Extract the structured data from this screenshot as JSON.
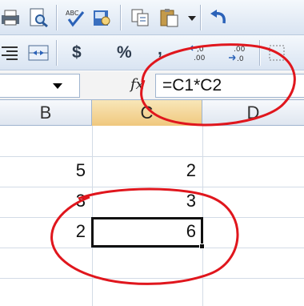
{
  "toolbar_standard": {
    "buttons": [
      "print-icon",
      "print-preview-icon",
      "spelling-icon",
      "research-icon",
      "copy-icon",
      "paste-icon",
      "dropdown-arrow-icon",
      "undo-icon"
    ]
  },
  "toolbar_formatting": {
    "currency_label": "$",
    "percent_label": "%",
    "comma_label": ","
  },
  "formula_bar": {
    "fx_label": "fx",
    "formula": "=C1*C2"
  },
  "columns": [
    "B",
    "C",
    "D"
  ],
  "rows": [
    {
      "b": "5",
      "c": "2"
    },
    {
      "b": "3",
      "c": "3"
    },
    {
      "b": "2",
      "c": "6"
    }
  ],
  "annotation_color": "#e0161d",
  "selected_column_color": "#f0c87e"
}
